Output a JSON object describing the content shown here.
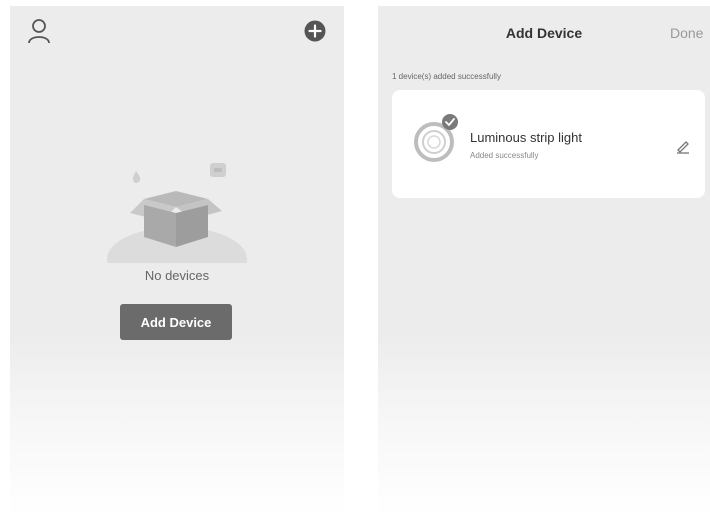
{
  "left_screen": {
    "header": {
      "user_icon": "user-icon",
      "add_icon": "plus-circle-icon"
    },
    "empty_state": {
      "illustration": "empty-box-icon",
      "message": "No devices",
      "button_label": "Add Device"
    }
  },
  "right_screen": {
    "header": {
      "title": "Add Device",
      "done_label": "Done"
    },
    "summary": "1 device(s) added successfully",
    "devices": [
      {
        "name": "Luminous strip light",
        "status": "Added successfully",
        "icon": "strip-light-icon",
        "badge_icon": "check-badge-icon",
        "edit_icon": "pencil-icon"
      }
    ]
  },
  "colors": {
    "screen_bg": "#ececec",
    "card_bg": "#ffffff",
    "button_bg": "#6b6b6b",
    "text_primary": "#333333",
    "text_secondary": "#888888"
  }
}
